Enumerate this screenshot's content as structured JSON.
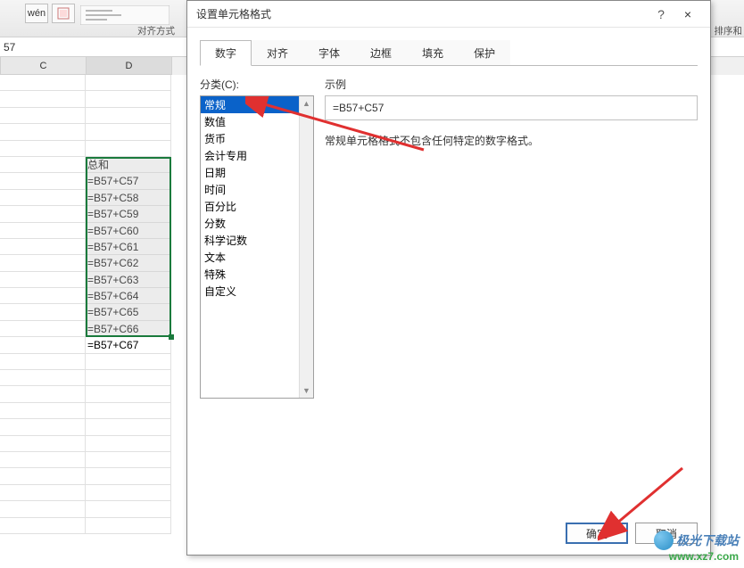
{
  "ribbon": {
    "wen_label": "wén",
    "align_group": "对齐方式",
    "sort_label": "排序和"
  },
  "formula_bar": "57",
  "columns": {
    "C": "C",
    "D": "D"
  },
  "header_cell": "总和",
  "cells": [
    "=B57+C57",
    "=B57+C58",
    "=B57+C59",
    "=B57+C60",
    "=B57+C61",
    "=B57+C62",
    "=B57+C63",
    "=B57+C64",
    "=B57+C65",
    "=B57+C66",
    "=B57+C67"
  ],
  "dialog": {
    "title": "设置单元格格式",
    "help": "?",
    "close": "×",
    "tabs": [
      "数字",
      "对齐",
      "字体",
      "边框",
      "填充",
      "保护"
    ],
    "category_label": "分类(C):",
    "categories": [
      "常规",
      "数值",
      "货币",
      "会计专用",
      "日期",
      "时间",
      "百分比",
      "分数",
      "科学记数",
      "文本",
      "特殊",
      "自定义"
    ],
    "sample_label": "示例",
    "sample_value": "=B57+C57",
    "description": "常规单元格格式不包含任何特定的数字格式。",
    "ok": "确定",
    "cancel": "取消"
  },
  "watermark": {
    "line1": "极光下载站",
    "line2": "www.xz7.com"
  }
}
